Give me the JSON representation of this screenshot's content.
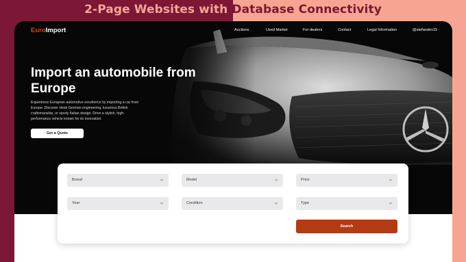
{
  "banner": {
    "title_part1": "2-Page Websites with ",
    "title_part2": "Database Connectivity"
  },
  "colors": {
    "banner_left": "#7c1735",
    "banner_right": "#f7a592",
    "accent": "#d4441c",
    "search_button": "#b23b14"
  },
  "navbar": {
    "logo_part1": "Euro",
    "logo_part2": "Import",
    "links": [
      "Auctions",
      "Used Market",
      "For dealers",
      "Contact",
      "Legal Information",
      "@stefandev15"
    ]
  },
  "hero": {
    "title": "Import an automobile from Europe",
    "description": "Experience European automotive excellence by importing a car from Europe. Discover sleek German engineering, luxurious British craftsmanship, or sporty Italian design. Drive a stylish, high-performance vehicle known for its innovation.",
    "cta_label": "Get a Quote"
  },
  "search": {
    "fields": [
      {
        "label": "Brand"
      },
      {
        "label": "Model"
      },
      {
        "label": "Price"
      },
      {
        "label": "Year"
      },
      {
        "label": "Condition"
      },
      {
        "label": "Type"
      }
    ],
    "button_label": "Search"
  },
  "icons": {
    "dropdown": "chevron-down-icon"
  }
}
